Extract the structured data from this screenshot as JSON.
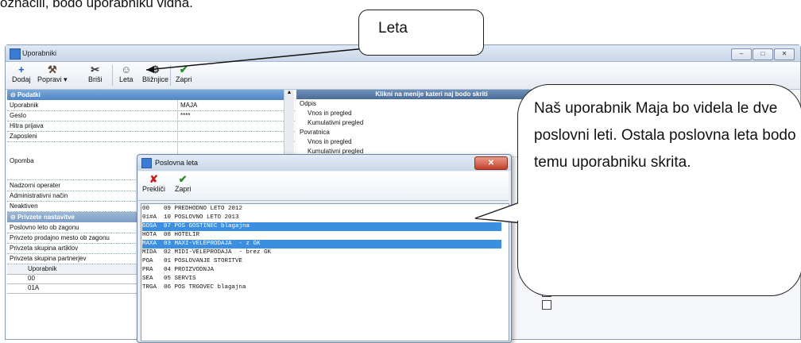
{
  "intro_text": "označili, bodo uporabniku vidna.",
  "callout_leta": "Leta",
  "callout_note": "Naš uporabnik Maja bo videla le dve poslovni leti. Ostala poslovna leta bodo temu uporabniku skrita.",
  "window": {
    "title": "Uporabniki",
    "controls": [
      "–",
      "□",
      "✕"
    ]
  },
  "toolbar": {
    "add": "Dodaj",
    "edit": "Popravi",
    "delete": "Briši",
    "years": "Leta",
    "shortcuts": "Bližnjice",
    "close": "Zapri"
  },
  "data_section": {
    "header": "Podatki",
    "rows": [
      {
        "label": "Uporabnik",
        "value": "MAJA"
      },
      {
        "label": "Geslo",
        "value": "****"
      },
      {
        "label": "Hitra prijava",
        "value": ""
      },
      {
        "label": "Zaposleni",
        "value": ""
      },
      {
        "label": "Opomba",
        "value": ""
      },
      {
        "label": "Nadzorni operater",
        "value": ""
      },
      {
        "label": "Administrativni način",
        "value": ""
      },
      {
        "label": "Neaktiven",
        "value": ""
      }
    ]
  },
  "defaults_section": {
    "header": "Privzete nastavitve",
    "rows": [
      "Poslovno leto ob zagonu",
      "Privzeto prodajno mesto ob zagonu",
      "Privzeta skupina artiklov",
      "Privzeta skupina partnerjev"
    ]
  },
  "subtable": {
    "header": "Uporabnik",
    "rows": [
      "00",
      "01A"
    ]
  },
  "menu_panel": {
    "header": "Klikni na menije kateri naj bodo skriti",
    "items": [
      "Odpis",
      "Vnos in pregled",
      "Kumulativni pregled",
      "Povratnica",
      "Vnos in pregled",
      "Kumulativni pregled"
    ]
  },
  "dialog": {
    "title": "Poslovna leta",
    "cancel": "Prekliči",
    "close": "Zapri",
    "close_icon": "✕",
    "items": [
      {
        "code": "00  ",
        "text": "09 PREDHODNO LETO 2012",
        "selected": false
      },
      {
        "code": "01#A",
        "text": "10 POSLOVNO LETO 2013",
        "selected": false
      },
      {
        "code": "GOSA",
        "text": "07 POS GOSTINEC blagajna",
        "selected": true
      },
      {
        "code": "HOTA",
        "text": "08 HOTELIR",
        "selected": false
      },
      {
        "code": "MAXA",
        "text": "03 MAXI-VELEPRODAJA  - z GK",
        "selected": true
      },
      {
        "code": "MIDA",
        "text": "02 MIDI-VELEPRODAJA  - brez GK",
        "selected": false
      },
      {
        "code": "POA ",
        "text": "01 POSLOVANJE STORITVE",
        "selected": false
      },
      {
        "code": "PRA ",
        "text": "04 PROIZVODNJA",
        "selected": false
      },
      {
        "code": "SEA ",
        "text": "05 SERVIS",
        "selected": false
      },
      {
        "code": "TRGA",
        "text": "06 POS TRGOVEC blagajna",
        "selected": false
      }
    ]
  }
}
